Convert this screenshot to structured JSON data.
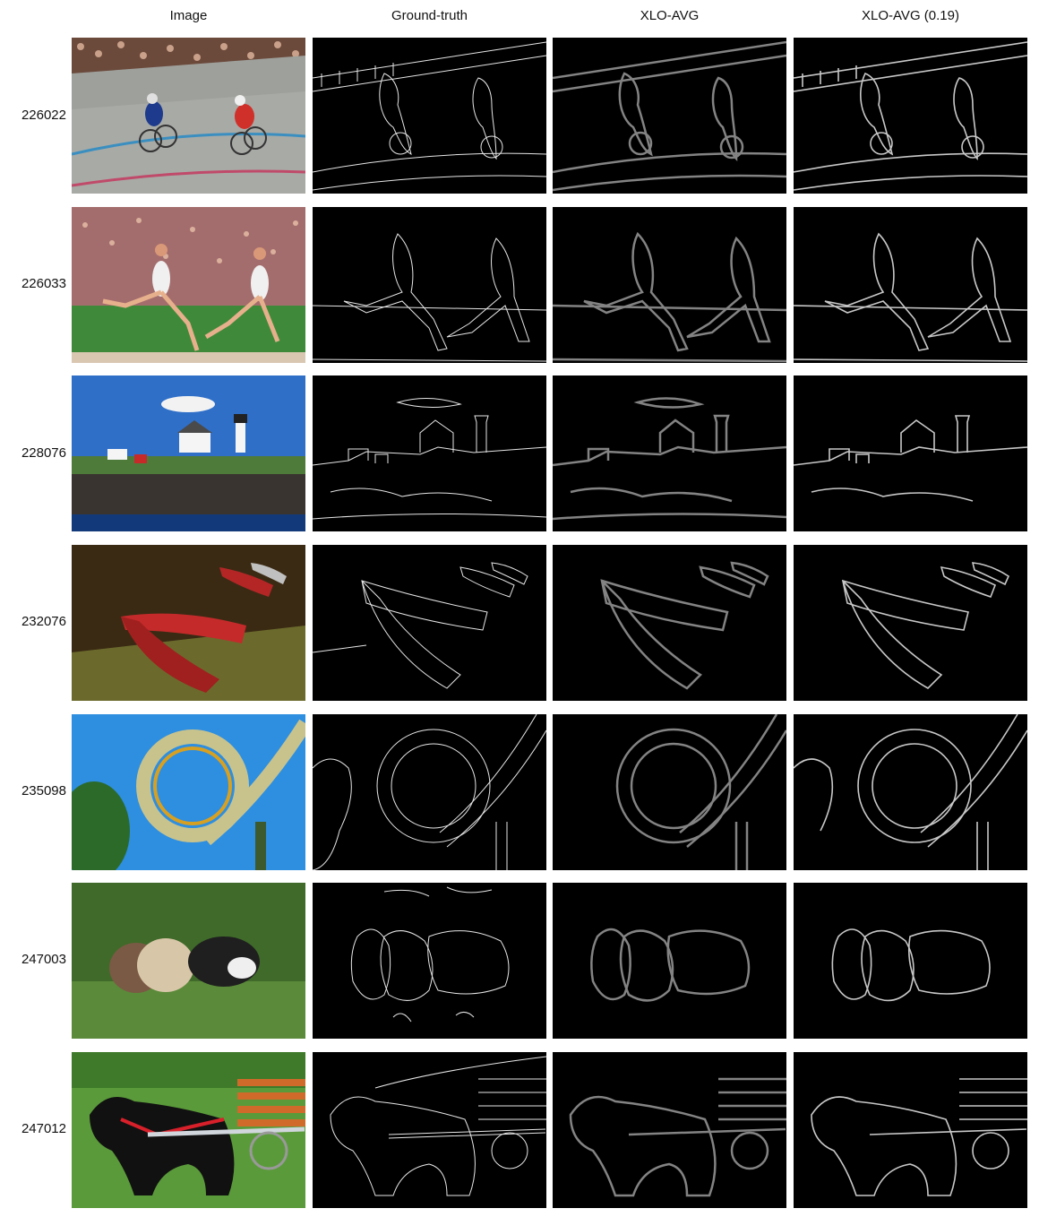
{
  "columns": [
    "Image",
    "Ground-truth",
    "XLO-AVG",
    "XLO-AVG (0.19)"
  ],
  "rows": [
    {
      "id": "226022",
      "scene": "cyclists on velodrome track"
    },
    {
      "id": "226033",
      "scene": "runners on stadium track"
    },
    {
      "id": "228076",
      "scene": "lighthouse on rocky island"
    },
    {
      "id": "232076",
      "scene": "red canoes on grass"
    },
    {
      "id": "235098",
      "scene": "roller coaster loop against sky"
    },
    {
      "id": "247003",
      "scene": "three husky puppies in grass"
    },
    {
      "id": "247012",
      "scene": "black dog pulling cart"
    }
  ]
}
